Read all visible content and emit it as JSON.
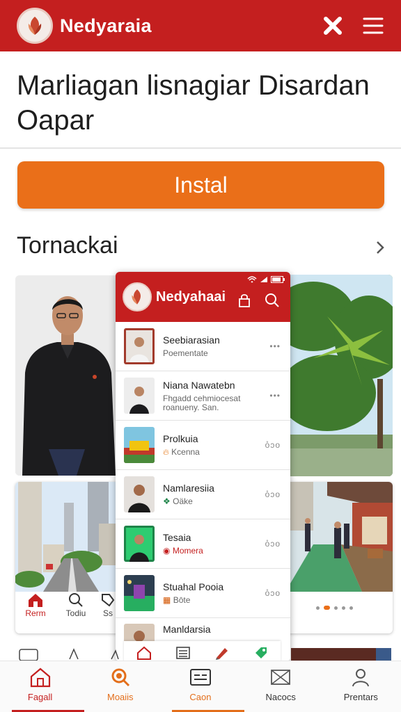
{
  "appbar": {
    "title": "Nedyaraia",
    "close_icon": "close-x-icon",
    "menu_icon": "hamburger-menu-icon",
    "color": "#c41f1f"
  },
  "app": {
    "name": "Marliagan lisnagiar Disardan Oapar",
    "install_label": "Instal",
    "install_color": "#ea6f19"
  },
  "section": {
    "title": "Tornackai"
  },
  "preview_left": {
    "nav": [
      {
        "label": "Rerm",
        "icon": "home-icon"
      },
      {
        "label": "Todiu",
        "icon": "search-icon"
      },
      {
        "label": "Ss",
        "icon": "tag-icon"
      }
    ]
  },
  "phone": {
    "title": "Nedyahaai",
    "items": [
      {
        "title": "Seebiarasian",
        "subtitle": "Poementate",
        "more": "•••"
      },
      {
        "title": "Niana Nawatebn",
        "subtitle": "Fhgadd cehmiocesat roanueny. San.",
        "more": "•••"
      },
      {
        "title": "Prolkuia",
        "subtitle": "Kcenna",
        "more": "o̊ɔo"
      },
      {
        "title": "Namlaresiia",
        "subtitle": "Oäke",
        "more": "o̊ɔo"
      },
      {
        "title": "Tesaia",
        "subtitle": "Momera",
        "more": "o̊ɔo"
      },
      {
        "title": "Stuahal Pooia",
        "subtitle": "Bōte",
        "more": "o̊ɔo"
      },
      {
        "title": "Manldarsia",
        "subtitle": "",
        "more": ""
      }
    ]
  },
  "bottom_nav": [
    {
      "label": "Fagall",
      "icon": "home-icon",
      "color": "#c41f1f"
    },
    {
      "label": "Moaiis",
      "icon": "search-icon",
      "color": "#e36e1a"
    },
    {
      "label": "Caon",
      "icon": "card-icon",
      "color": "#e36e1a"
    },
    {
      "label": "Nacocs",
      "icon": "mail-icon",
      "color": "#555555"
    },
    {
      "label": "Prentars",
      "icon": "person-icon",
      "color": "#555555"
    }
  ]
}
